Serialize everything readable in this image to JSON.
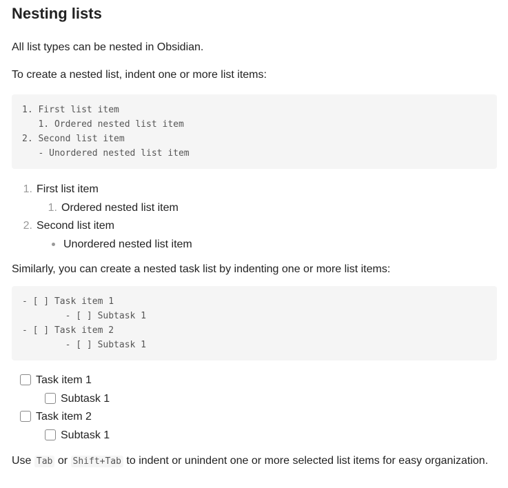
{
  "heading": "Nesting lists",
  "intro1": "All list types can be nested in Obsidian.",
  "intro2": "To create a nested list, indent one or more list items:",
  "code1": {
    "line1": "1. First list item",
    "line2": "   1. Ordered nested list item",
    "line3": "2. Second list item",
    "line4": "   - Unordered nested list item"
  },
  "list1": {
    "item1_num": "1.",
    "item1_text": "First list item",
    "item1a_num": "1.",
    "item1a_text": "Ordered nested list item",
    "item2_num": "2.",
    "item2_text": "Second list item",
    "item2a_text": "Unordered nested list item"
  },
  "intro3": "Similarly, you can create a nested task list by indenting one or more list items:",
  "code2": {
    "line1": "- [ ] Task item 1",
    "line2": "        - [ ] Subtask 1",
    "line3": "- [ ] Task item 2",
    "line4": "        - [ ] Subtask 1"
  },
  "tasks": {
    "task1": "Task item 1",
    "subtask1": "Subtask 1",
    "task2": "Task item 2",
    "subtask2": "Subtask 1"
  },
  "footer": {
    "pre": "Use ",
    "code_tab": "Tab",
    "mid": " or ",
    "code_shift_tab": "Shift+Tab",
    "post": " to indent or unindent one or more selected list items for easy organization."
  }
}
